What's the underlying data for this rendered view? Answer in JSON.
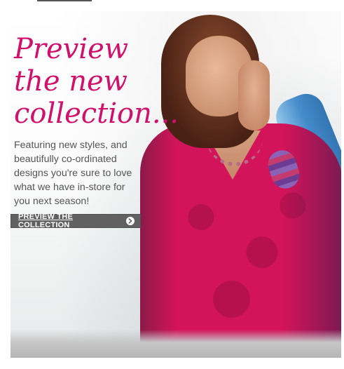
{
  "promo": {
    "headline": "Preview\nthe new\ncollection...",
    "body": "Featuring new styles, and\nbeautifully co-ordinated\ndesigns you're sure to love\nwhat we have in-store for\nyou next season!",
    "cta_label": "PREVIEW THE COLLECTION",
    "cta_icon": "chevron-right-circle-icon"
  },
  "colors": {
    "headline_pink": "#d0106a",
    "button_gray": "#616161",
    "body_text": "#555555"
  }
}
